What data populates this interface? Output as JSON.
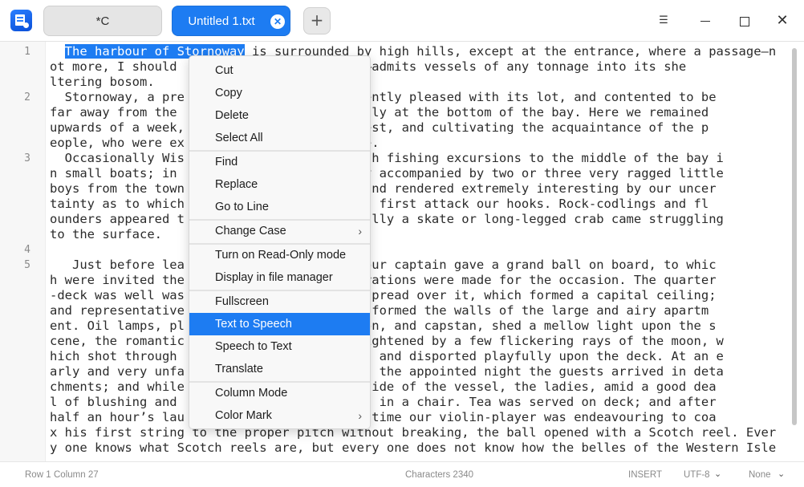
{
  "titlebar": {
    "tabs": [
      {
        "label": "*C",
        "active": false
      },
      {
        "label": "Untitled 1.txt",
        "active": true
      }
    ],
    "close_tab_glyph": "✕",
    "add_tab_glyph": "+",
    "menu_glyph": "☰",
    "close_glyph": "✕"
  },
  "editor": {
    "line_numbers": [
      "1",
      "2",
      "3",
      "4",
      "5"
    ],
    "selected_text": "The harbour of Stornoway",
    "lines": [
      {
        "text": "  "
      },
      {
        "text": " is surrounded by high hills, except at the entrance, where a passage—n"
      },
      {
        "text": "ot more, I should            ed yards wide—admits vessels of any tonnage into its she"
      },
      {
        "text": "ltering bosom."
      },
      {
        "text": "  Stornoway, a pre                n, apparently pleased with its lot, and contented to be"
      },
      {
        "text": "far away from the                 lies snugly at the bottom of the bay. Here we remained"
      },
      {
        "text": "upwards of a week,               ld Nor’-West, and cultivating the acquaintance of the p"
      },
      {
        "text": "eople, who were ex                ospitable."
      },
      {
        "text": "  Occasionally Wis                elves with fishing excursions to the middle of the bay i"
      },
      {
        "text": "n small boats; in                 e usually accompanied by two or three very ragged little"
      },
      {
        "text": "boys from the town                y good, and rendered extremely interesting by our uncer"
      },
      {
        "text": "tainty as to which               deep would first attack our hooks. Rock-codlings and fl"
      },
      {
        "text": "ounders appeared t                occasionally a skate or long-legged crab came struggling"
      },
      {
        "text": "to the surface."
      },
      {
        "text": ""
      },
      {
        "text": "   Just before lea                e spot, our captain gave a grand ball on board, to whic"
      },
      {
        "text": "h were invited the               eat preparations were made for the occasion. The quarter"
      },
      {
        "text": "-deck was well was                ing was spread over it, which formed a capital ceiling;"
      },
      {
        "text": "and representative               hat waves formed the walls of the large and airy apartm"
      },
      {
        "text": "ent. Oil lamps, pl                 companion, and capstan, shed a mellow light upon the s"
      },
      {
        "text": "cene, the romantic                eatly heightened by a few flickering rays of the moon, w"
      },
      {
        "text": "hich shot through                  drapery, and disported playfully upon the deck. At an e"
      },
      {
        "text": "arly and very unfa                vening of the appointed night the guests arrived in deta"
      },
      {
        "text": "chments; and while                 up the side of the vessel, the ladies, amid a good dea"
      },
      {
        "text": "l of blushing and                  on board in a chair. Tea was served on deck; and after"
      },
      {
        "text": "half an hour’s lau                ng which time our violin-player was endeavouring to coa"
      },
      {
        "text": "x his first string to the proper pitch without breaking, the ball opened with a Scotch reel. Ever"
      },
      {
        "text": "y one knows what Scotch reels are, but every one does not know how the belles of the Western Isle"
      }
    ]
  },
  "context_menu": {
    "items": [
      {
        "label": "Cut"
      },
      {
        "label": "Copy"
      },
      {
        "label": "Delete"
      },
      {
        "label": "Select All"
      },
      {
        "label": "Find"
      },
      {
        "label": "Replace"
      },
      {
        "label": "Go to Line"
      },
      {
        "label": "Change Case",
        "submenu": true
      },
      {
        "label": "Turn on Read-Only mode"
      },
      {
        "label": "Display in file manager"
      },
      {
        "label": "Fullscreen"
      },
      {
        "label": "Text to Speech",
        "highlighted": true
      },
      {
        "label": "Speech to Text"
      },
      {
        "label": "Translate"
      },
      {
        "label": "Column Mode"
      },
      {
        "label": "Color Mark",
        "submenu": true
      }
    ],
    "submenu_glyph": "›"
  },
  "statusbar": {
    "row": "Row 1",
    "column": "Column 27",
    "characters": "Characters 2340",
    "insert_mode": "INSERT",
    "encoding": "UTF-8",
    "highlight": "None",
    "chevron_glyph": "⌄"
  },
  "colors": {
    "accent": "#1d7cf2",
    "menu_background": "#f8f8f8",
    "text": "#2b2b2b"
  }
}
